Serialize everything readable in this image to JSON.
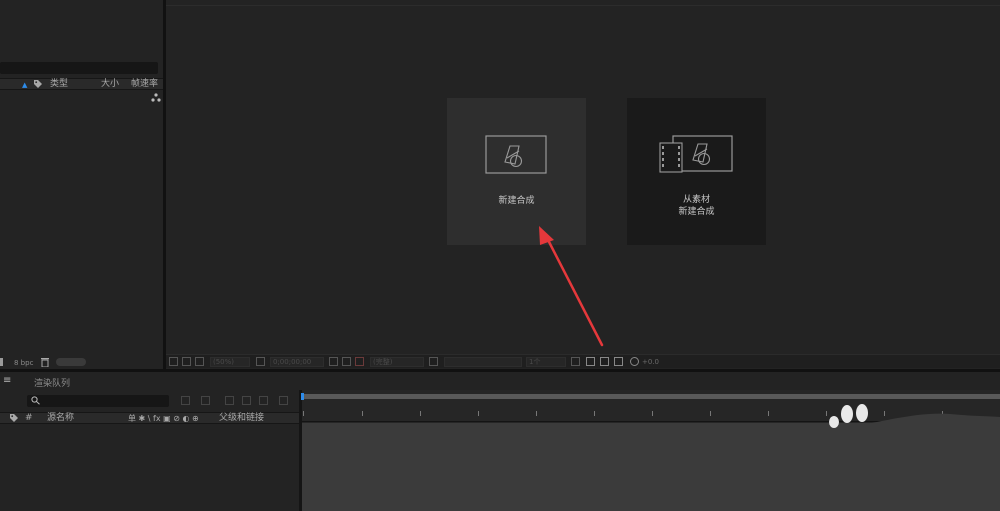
{
  "project_panel": {
    "columns": {
      "type": "类型",
      "size": "大小",
      "frame_rate": "帧速率"
    },
    "bit_depth": "8 bpc"
  },
  "viewer": {
    "toolbar": {
      "zoom": "(50%)",
      "timecode": "0;00;00;00",
      "resolution": "(完整)",
      "views": "1个",
      "exposure": "+0.0"
    }
  },
  "start_cards": {
    "new_composition": {
      "label": "新建合成"
    },
    "from_footage": {
      "line1": "从素材",
      "line2": "新建合成"
    }
  },
  "timeline": {
    "tabs": {
      "menu_icon": "≡",
      "render_queue": "渲染队列"
    },
    "layer_columns": {
      "number": "#",
      "source_name": "源名称",
      "switches": "单 ✱ \\ fx ▣ ⊘ ◐ ⊕",
      "parent": "父级和链接"
    }
  },
  "annotation": {
    "arrow_color": "#e5383b"
  }
}
